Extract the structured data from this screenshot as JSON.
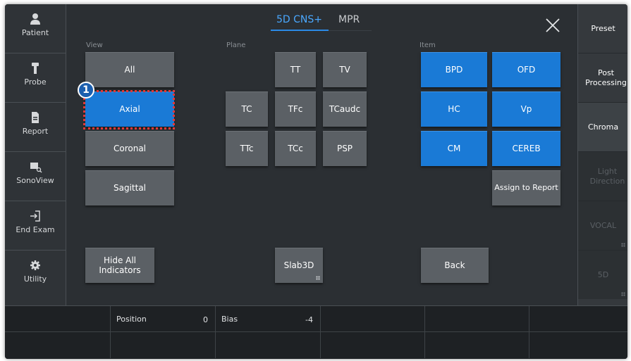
{
  "sidebar_left": [
    {
      "label": "Patient",
      "icon": "person-icon"
    },
    {
      "label": "Probe",
      "icon": "probe-icon"
    },
    {
      "label": "Report",
      "icon": "document-icon"
    },
    {
      "label": "SonoView",
      "icon": "sonoview-icon"
    },
    {
      "label": "End Exam",
      "icon": "exit-icon"
    },
    {
      "label": "Utility",
      "icon": "gear-icon"
    }
  ],
  "sidebar_right": [
    {
      "label": "Preset",
      "enabled": true
    },
    {
      "label": "Post Processing",
      "enabled": true
    },
    {
      "label": "Chroma",
      "enabled": true
    },
    {
      "label": "Light Direction",
      "enabled": false
    },
    {
      "label": "VOCAL",
      "enabled": false
    },
    {
      "label": "5D",
      "enabled": false
    }
  ],
  "tabs": [
    {
      "label": "5D CNS+",
      "active": true
    },
    {
      "label": "MPR",
      "active": false
    }
  ],
  "sections": {
    "view": "View",
    "plane": "Plane",
    "item": "Item"
  },
  "view_buttons": [
    "All",
    "Axial",
    "Coronal",
    "Sagittal"
  ],
  "view_selected": "Axial",
  "plane_buttons": {
    "row1": [
      "TT",
      "TV"
    ],
    "row2": [
      "TC",
      "TFc",
      "TCaudc"
    ],
    "row3": [
      "TTc",
      "TCc",
      "PSP"
    ]
  },
  "item_buttons": [
    "BPD",
    "OFD",
    "HC",
    "Vp",
    "CM",
    "CEREB"
  ],
  "assign_label": "Assign to Report",
  "hide_all_label": "Hide All Indicators",
  "slab_label": "Slab3D",
  "back_label": "Back",
  "annotation_number": "1",
  "bottom": {
    "position_label": "Position",
    "position_value": "0",
    "bias_label": "Bias",
    "bias_value": "-4"
  },
  "colors": {
    "accent": "#1a7ad6",
    "highlight": "#e53838",
    "background": "#2b2f33"
  }
}
